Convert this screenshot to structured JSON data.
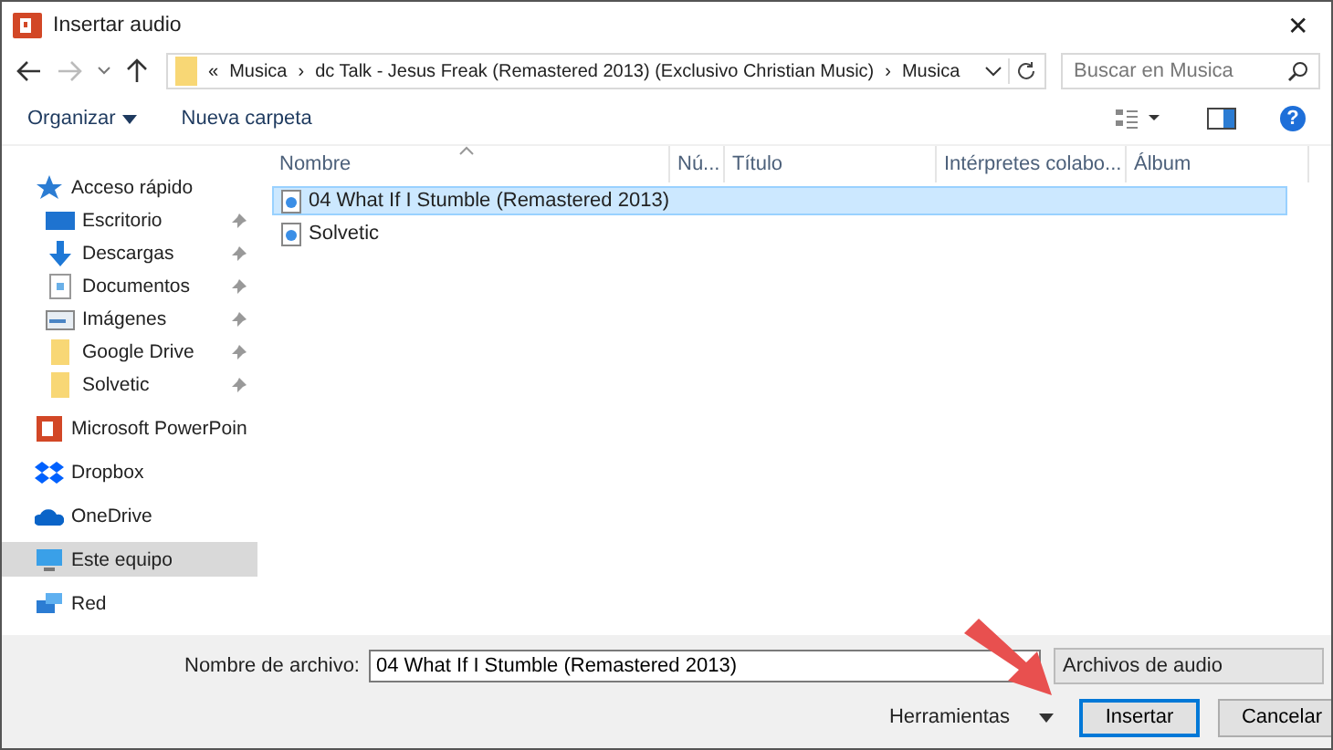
{
  "window": {
    "title": "Insertar audio",
    "close": "✕"
  },
  "address": {
    "overflow": "«",
    "path": [
      "Musica",
      "dc Talk - Jesus Freak (Remastered 2013) (Exclusivo Christian Music)",
      "Musica"
    ],
    "separator": "›"
  },
  "search": {
    "placeholder": "Buscar en Musica"
  },
  "toolbar": {
    "organize": "Organizar",
    "new_folder": "Nueva carpeta",
    "help": "?"
  },
  "sidebar": {
    "items": [
      {
        "label": "Acceso rápido",
        "selected": false,
        "children": [
          {
            "label": "Escritorio",
            "pinned": true
          },
          {
            "label": "Descargas",
            "pinned": true
          },
          {
            "label": "Documentos",
            "pinned": true
          },
          {
            "label": "Imágenes",
            "pinned": true
          },
          {
            "label": "Google Drive",
            "pinned": true
          },
          {
            "label": "Solvetic",
            "pinned": true
          }
        ]
      },
      {
        "label": "Microsoft PowerPoin",
        "selected": false
      },
      {
        "label": "Dropbox",
        "selected": false
      },
      {
        "label": "OneDrive",
        "selected": false
      },
      {
        "label": "Este equipo",
        "selected": true
      },
      {
        "label": "Red",
        "selected": false
      }
    ]
  },
  "table": {
    "columns": [
      "Nombre",
      "Nú...",
      "Título",
      "Intérpretes colabo...",
      "Álbum"
    ],
    "rows": [
      {
        "name": "04 What If I Stumble (Remastered 2013)",
        "selected": true
      },
      {
        "name": "Solvetic",
        "selected": false
      }
    ]
  },
  "footer": {
    "filename_label": "Nombre de archivo:",
    "filename": "04 What If I Stumble (Remastered 2013)",
    "filter": "Archivos de audio",
    "tools": "Herramientas",
    "insert": "Insertar",
    "cancel": "Cancelar"
  }
}
